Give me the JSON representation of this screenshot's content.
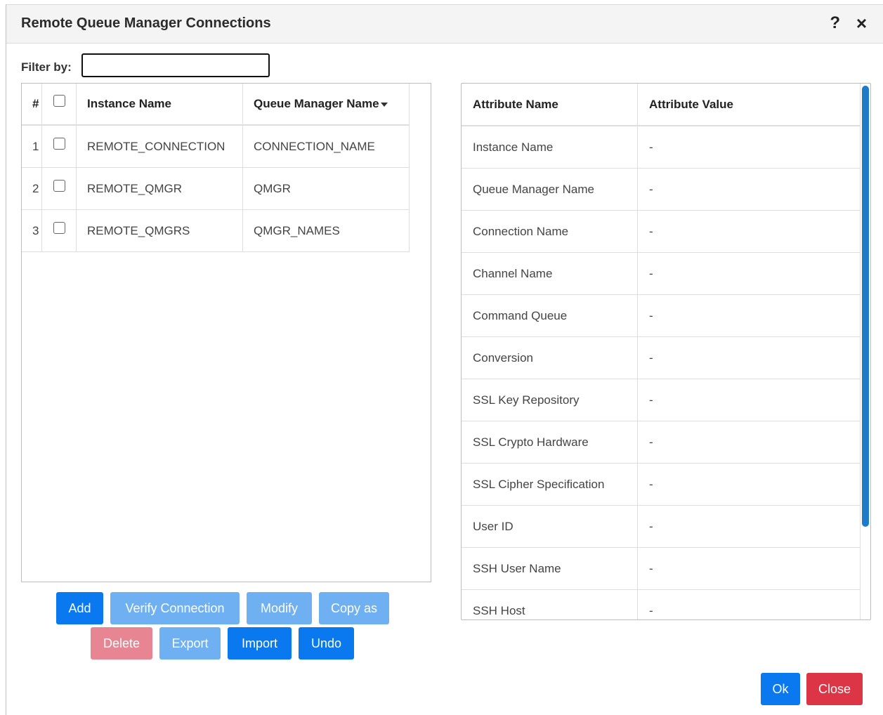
{
  "dialog": {
    "title": "Remote Queue Manager Connections",
    "help_icon": "?",
    "close_icon": "×"
  },
  "filter": {
    "label": "Filter by:",
    "value": ""
  },
  "left_table": {
    "headers": [
      "#",
      "Instance Name",
      "Queue Manager Name"
    ],
    "rows": [
      {
        "num": "1",
        "instance": "REMOTE_CONNECTION",
        "qmgr": "CONNECTION_NAME"
      },
      {
        "num": "2",
        "instance": "REMOTE_QMGR",
        "qmgr": "QMGR"
      },
      {
        "num": "3",
        "instance": "REMOTE_QMGRS",
        "qmgr": "QMGR_NAMES"
      }
    ]
  },
  "attributes": {
    "headers": [
      "Attribute Name",
      "Attribute Value"
    ],
    "rows": [
      {
        "name": "Instance Name",
        "value": "-"
      },
      {
        "name": "Queue Manager Name",
        "value": "-"
      },
      {
        "name": "Connection Name",
        "value": "-"
      },
      {
        "name": "Channel Name",
        "value": "-"
      },
      {
        "name": "Command Queue",
        "value": "-"
      },
      {
        "name": "Conversion",
        "value": "-"
      },
      {
        "name": "SSL Key Repository",
        "value": "-"
      },
      {
        "name": "SSL Crypto Hardware",
        "value": "-"
      },
      {
        "name": "SSL Cipher Specification",
        "value": "-"
      },
      {
        "name": "User ID",
        "value": "-"
      },
      {
        "name": "SSH User Name",
        "value": "-"
      },
      {
        "name": "SSH Host",
        "value": "-"
      }
    ]
  },
  "buttons": {
    "add": "Add",
    "verify": "Verify Connection",
    "modify": "Modify",
    "copy_as": "Copy as",
    "delete": "Delete",
    "export": "Export",
    "import": "Import",
    "undo": "Undo",
    "ok": "Ok",
    "close": "Close"
  },
  "colors": {
    "primary": "#0a78ee",
    "primary_disabled": "#6fb0f3",
    "danger": "#dc3545",
    "danger_disabled": "#e88592",
    "scrollbar": "#1f7bc8"
  }
}
